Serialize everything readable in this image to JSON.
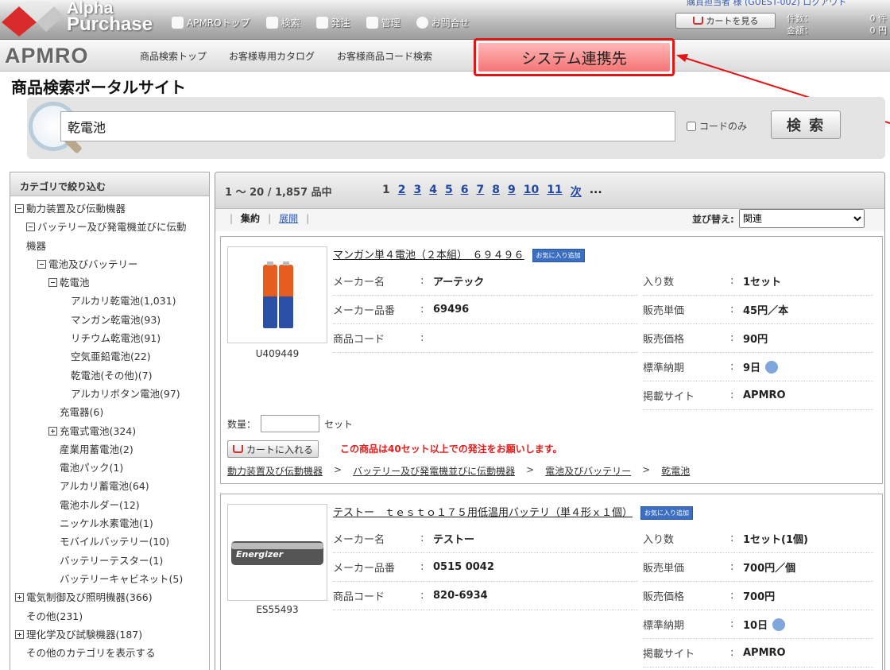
{
  "header": {
    "logo_line1": "Alpha",
    "logo_line2": "Purchase",
    "nav": [
      "APMROトップ",
      "検索",
      "発注",
      "管理",
      "お問合せ"
    ],
    "user": "購買担当者 様 (GUEST-002)  ログアウト",
    "cart_button": "カートを見る",
    "count_label": "件数：",
    "count_value": "0 件",
    "total_label": "金額：",
    "total_value": "0 円"
  },
  "subnav": {
    "brand": "APMRO",
    "links": [
      "商品検索トップ",
      "お客様専用カタログ",
      "お客様商品コード検索"
    ],
    "system_link": "システム連携先"
  },
  "page_title": "商品検索ポータルサイト",
  "search": {
    "value": "乾電池",
    "code_only_label": "コードのみ",
    "button": "検 索"
  },
  "sidebar": {
    "heading": "カテゴリで絞り込む",
    "items": [
      {
        "label": "動力装置及び伝動機器",
        "depth": 0,
        "box": "minus"
      },
      {
        "label": "バッテリー及び発電機並びに伝動",
        "depth": 1,
        "box": "minus"
      },
      {
        "label": "機器",
        "depth": 1,
        "box": "none"
      },
      {
        "label": "電池及びバッテリー",
        "depth": 2,
        "box": "minus"
      },
      {
        "label": "乾電池",
        "depth": 3,
        "box": "minus"
      },
      {
        "label": "アルカリ乾電池(1,031)",
        "depth": 5,
        "box": "none"
      },
      {
        "label": "マンガン乾電池(93)",
        "depth": 5,
        "box": "none"
      },
      {
        "label": "リチウム乾電池(91)",
        "depth": 5,
        "box": "none"
      },
      {
        "label": "空気亜鉛電池(22)",
        "depth": 5,
        "box": "none"
      },
      {
        "label": "乾電池(その他)(7)",
        "depth": 5,
        "box": "none"
      },
      {
        "label": "アルカリボタン電池(97)",
        "depth": 5,
        "box": "none"
      },
      {
        "label": "充電器(6)",
        "depth": 4,
        "box": "none"
      },
      {
        "label": "充電式電池(324)",
        "depth": 3,
        "box": "plus"
      },
      {
        "label": "産業用蓄電池(2)",
        "depth": 4,
        "box": "none"
      },
      {
        "label": "電池パック(1)",
        "depth": 4,
        "box": "none"
      },
      {
        "label": "アルカリ蓄電池(64)",
        "depth": 4,
        "box": "none"
      },
      {
        "label": "電池ホルダー(12)",
        "depth": 4,
        "box": "none"
      },
      {
        "label": "ニッケル水素電池(1)",
        "depth": 4,
        "box": "none"
      },
      {
        "label": "モバイルバッテリー(10)",
        "depth": 4,
        "box": "none"
      },
      {
        "label": "バッテリーテスター(1)",
        "depth": 4,
        "box": "none"
      },
      {
        "label": "バッテリーキャビネット(5)",
        "depth": 4,
        "box": "none"
      },
      {
        "label": "電気制御及び照明機器(366)",
        "depth": 0,
        "box": "plus"
      },
      {
        "label": "その他(231)",
        "depth": 1,
        "box": "none"
      },
      {
        "label": "理化学及び試験機器(187)",
        "depth": 0,
        "box": "plus"
      },
      {
        "label": "その他のカテゴリを表示する",
        "depth": 1,
        "box": "none"
      }
    ]
  },
  "results": {
    "count": "1 ～ 20  /  1,857 品中",
    "pages": [
      "1",
      "2",
      "3",
      "4",
      "5",
      "6",
      "7",
      "8",
      "9",
      "10",
      "11",
      "次",
      "..."
    ],
    "view_compact": "集約",
    "view_expand": "展開",
    "sort_label": "並び替え:",
    "sort_value": "関連"
  },
  "products": [
    {
      "title": "マンガン単４電池（２本組）　６９４９６",
      "fav": "お気に入り追加",
      "sku": "U409449",
      "maker_label": "メーカー名",
      "maker": "アーテック",
      "part_label": "メーカー品番",
      "part": "69496",
      "code_label": "商品コード",
      "code": "",
      "qty_label": "入り数",
      "qty": "1セット",
      "unit_label": "販売単価",
      "unit": "45円／本",
      "price_label": "販売価格",
      "price": "90円",
      "lead_label": "標準納期",
      "lead": "9日",
      "site_label": "掲載サイト",
      "site": "APMRO",
      "qty_input_label": "数量：",
      "qty_unit": "セット",
      "cart_button": "カートに入れる",
      "notice": "この商品は40セット以上での発注をお願いします。",
      "crumbs": [
        "動力装置及び伝動機器",
        "バッテリー及び発電機並びに伝動機器",
        "電池及びバッテリー",
        "乾電池"
      ]
    },
    {
      "title": "テストー　ｔｅｓｔｏ１７５用低温用バッテリ（単４形ｘ１個）",
      "fav": "お気に入り追加",
      "sku": "ES55493",
      "maker_label": "メーカー名",
      "maker": "テストー",
      "part_label": "メーカー品番",
      "part": "0515 0042",
      "code_label": "商品コード",
      "code": "820-6934",
      "qty_label": "入り数",
      "qty": "1セット(1個)",
      "unit_label": "販売単価",
      "unit": "700円／個",
      "price_label": "販売価格",
      "price": "700円",
      "lead_label": "標準納期",
      "lead": "10日",
      "site_label": "掲載サイト",
      "site": "APMRO",
      "thumb_text": "Energizer"
    }
  ],
  "colors": {
    "accent_red": "#e31414",
    "link_blue": "#2247a3"
  }
}
